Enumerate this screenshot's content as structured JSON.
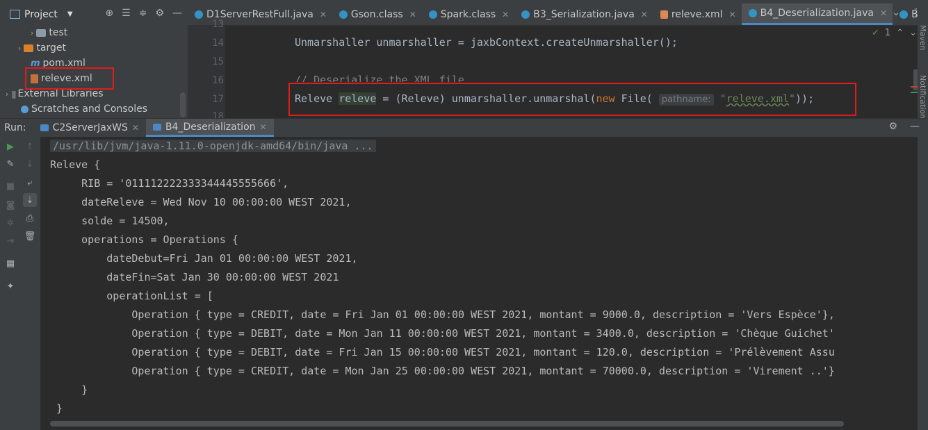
{
  "project_panel": {
    "title": "Project",
    "tree": [
      {
        "label": "test",
        "type": "folder"
      },
      {
        "label": "target",
        "type": "folder"
      },
      {
        "label": "pom.xml",
        "type": "maven-file"
      },
      {
        "label": "releve.xml",
        "type": "xml-file"
      },
      {
        "label": "External Libraries",
        "type": "library"
      },
      {
        "label": "Scratches and Consoles",
        "type": "scratch"
      }
    ]
  },
  "editor": {
    "tabs": [
      {
        "label": "D1ServerRestFull.java",
        "icon": "java-class-icon"
      },
      {
        "label": "Gson.class",
        "icon": "class-file-icon"
      },
      {
        "label": "Spark.class",
        "icon": "class-file-icon"
      },
      {
        "label": "B3_Serialization.java",
        "icon": "java-class-icon"
      },
      {
        "label": "releve.xml",
        "icon": "xml-file-icon"
      },
      {
        "label": "B4_Deserialization.java",
        "icon": "java-class-icon",
        "active": true
      },
      {
        "label": "B",
        "icon": "java-class-icon"
      }
    ],
    "line_numbers": [
      "13",
      "14",
      "15",
      "16",
      "17",
      "18"
    ],
    "line14": "Unmarshaller unmarshaller = jaxbContext.createUnmarshaller();",
    "line16": "// Deserialize the XML file",
    "line17": {
      "part1": "Releve ",
      "var": "releve",
      "part2": " = (Releve) unmarshaller.unmarshal(",
      "kw": "new",
      "part3": " File(",
      "hint": "pathname:",
      "str_quote_open": "\"",
      "str_value": "releve.xml",
      "str_quote_close": "\"",
      "part4": "));"
    },
    "inspection_count": "1",
    "right_strip_labels": {
      "maven": "Maven",
      "notifications": "Notifications"
    }
  },
  "run_panel": {
    "label": "Run:",
    "tabs": [
      {
        "label": "C2ServerJaxWS"
      },
      {
        "label": "B4_Deserialization",
        "active": true
      }
    ],
    "console_lines": [
      "/usr/lib/jvm/java-1.11.0-openjdk-amd64/bin/java ...",
      "Releve {",
      "     RIB = '011112222333344445555666',",
      "     dateReleve = Wed Nov 10 00:00:00 WEST 2021,",
      "     solde = 14500,",
      "     operations = Operations {",
      "         dateDebut=Fri Jan 01 00:00:00 WEST 2021,",
      "         dateFin=Sat Jan 30 00:00:00 WEST 2021",
      "         operationList = [",
      "             Operation { type = CREDIT, date = Fri Jan 01 00:00:00 WEST 2021, montant = 9000.0, description = 'Vers Espèce'},",
      "             Operation { type = DEBIT, date = Mon Jan 11 00:00:00 WEST 2021, montant = 3400.0, description = 'Chèque Guichet'",
      "             Operation { type = DEBIT, date = Fri Jan 15 00:00:00 WEST 2021, montant = 120.0, description = 'Prélèvement Assu",
      "             Operation { type = CREDIT, date = Mon Jan 25 00:00:00 WEST 2021, montant = 70000.0, description = 'Virement ..'}",
      "     }",
      " }"
    ]
  },
  "colors": {
    "highlight_box": "#e01c1c",
    "active_tab_underline": "#4a88c7",
    "keyword": "#cc7832",
    "string": "#6a8759"
  }
}
